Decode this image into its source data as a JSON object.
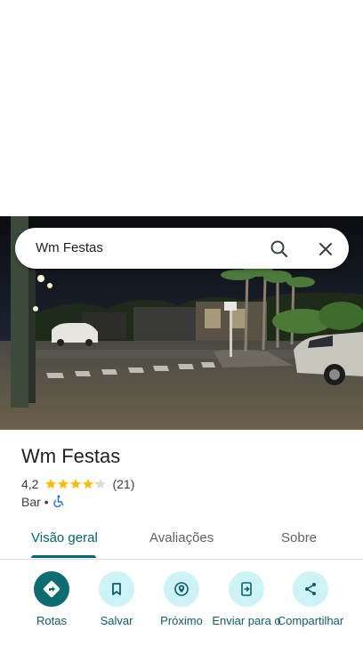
{
  "search": {
    "query": "Wm Festas"
  },
  "place": {
    "title": "Wm Festas",
    "rating": "4,2",
    "rating_value": 4.2,
    "rating_max": 5,
    "reviews": "(21)",
    "category": "Bar",
    "separator": "•",
    "accessibility_icon": "wheelchair-icon"
  },
  "tabs": [
    {
      "label": "Visão geral",
      "active": true
    },
    {
      "label": "Avaliações",
      "active": false
    },
    {
      "label": "Sobre",
      "active": false
    }
  ],
  "actions": [
    {
      "label": "Rotas",
      "icon": "directions-icon"
    },
    {
      "label": "Salvar",
      "icon": "bookmark-icon"
    },
    {
      "label": "Próximo",
      "icon": "nearby-icon"
    },
    {
      "label": "Enviar para o",
      "icon": "send-to-phone-icon"
    },
    {
      "label": "Compartilhar",
      "icon": "share-icon"
    }
  ],
  "colors": {
    "accent": "#00696e",
    "action_bg": "#cdf3f7",
    "primary_action_bg": "#0d6b72",
    "star": "#fbbc04",
    "accessibility": "#1a73e8"
  }
}
